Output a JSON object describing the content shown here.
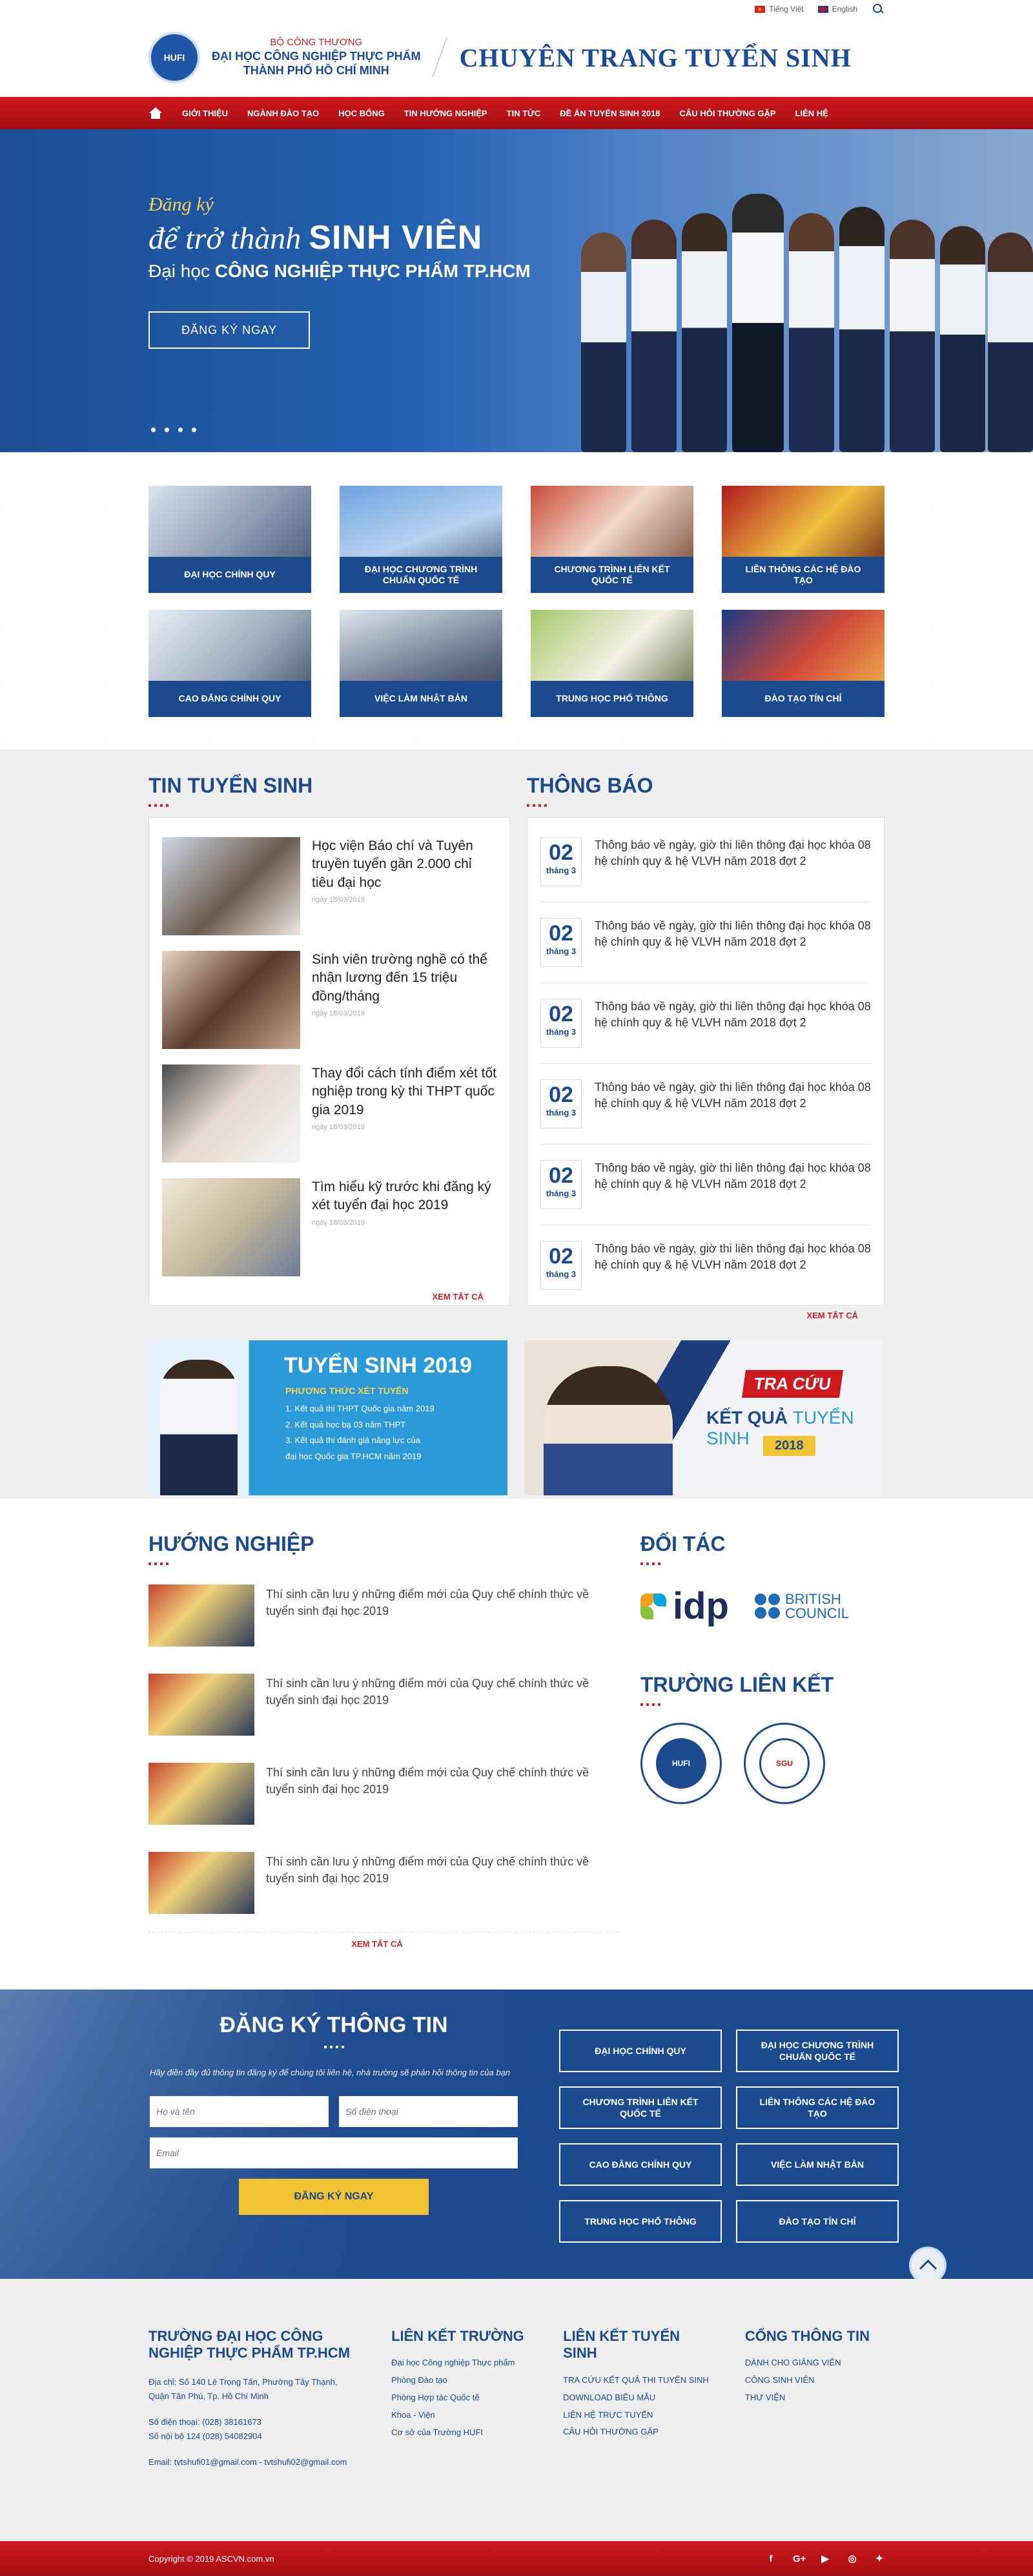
{
  "topbar": {
    "lang_vi": "Tiếng Việt",
    "lang_en": "English"
  },
  "header": {
    "logo_text": "HUFI",
    "ministry": "BỘ CÔNG THƯƠNG",
    "school_line1": "ĐẠI HỌC CÔNG NGHIỆP THỰC PHẨM",
    "school_line2": "THÀNH PHỐ HỒ CHÍ MINH",
    "site_title": "CHUYÊN TRANG TUYỂN SINH"
  },
  "nav": [
    "GIỚI THIỆU",
    "NGÀNH ĐÀO TẠO",
    "HỌC BỔNG",
    "TIN HƯỚNG NGHIỆP",
    "TIN TỨC",
    "ĐỀ ÁN TUYỂN SINH 2018",
    "CÂU HỎI THƯỜNG GẶP",
    "LIÊN HỆ"
  ],
  "hero": {
    "line1": "Đăng ký",
    "line2_a": "để trở thành ",
    "line2_b": "SINH VIÊN",
    "line3_a": "Đại học ",
    "line3_b": "CÔNG NGHIỆP THỰC PHẨM TP.HCM",
    "button": "ĐĂNG KÝ NGAY"
  },
  "programs": [
    "ĐẠI HỌC CHÍNH QUY",
    "ĐẠI HỌC CHƯƠNG TRÌNH CHUẨN QUỐC TẾ",
    "CHƯƠNG TRÌNH LIÊN KẾT QUỐC TẾ",
    "LIÊN THÔNG CÁC HỆ ĐÀO TẠO",
    "CAO ĐẲNG CHÍNH QUY",
    "VIỆC LÀM NHẬT BẢN",
    "TRUNG HỌC PHỔ THÔNG",
    "ĐÀO TẠO TÍN CHỈ"
  ],
  "news": {
    "title": "TIN TUYỂN SINH",
    "more": "XEM TẤT CẢ",
    "items": [
      {
        "headline": "Học viện Báo chí và Tuyên truyền tuyển gần 2.000 chỉ tiêu đại học",
        "date": "ngày 18/03/2019"
      },
      {
        "headline": "Sinh viên trường nghề có thể nhận lương đến 15 triệu đồng/tháng",
        "date": "ngày 18/03/2019"
      },
      {
        "headline": "Thay đổi cách tính điểm xét tốt nghiệp trong kỳ thi THPT quốc gia 2019",
        "date": "ngày 18/03/2019"
      },
      {
        "headline": "Tìm hiểu kỹ trước khi đăng ký xét tuyển đại học 2019",
        "date": "ngày 18/03/2019"
      }
    ]
  },
  "notices": {
    "title": "THÔNG BÁO",
    "more": "XEM TẤT CẢ",
    "items": [
      {
        "day": "02",
        "month": "tháng 3",
        "text": "Thông báo về ngày, giờ thi liên thông đại học khóa 08 hệ chính quy & hệ VLVH năm 2018 đợt 2"
      },
      {
        "day": "02",
        "month": "tháng 3",
        "text": "Thông báo về ngày, giờ thi liên thông đại học khóa 08 hệ chính quy & hệ VLVH năm 2018 đợt 2"
      },
      {
        "day": "02",
        "month": "tháng 3",
        "text": "Thông báo về ngày, giờ thi liên thông đại học khóa 08 hệ chính quy & hệ VLVH năm 2018 đợt 2"
      },
      {
        "day": "02",
        "month": "tháng 3",
        "text": "Thông báo về ngày, giờ thi liên thông đại học khóa 08 hệ chính quy & hệ VLVH năm 2018 đợt 2"
      },
      {
        "day": "02",
        "month": "tháng 3",
        "text": "Thông báo về ngày, giờ thi liên thông đại học khóa 08 hệ chính quy & hệ VLVH năm 2018 đợt 2"
      },
      {
        "day": "02",
        "month": "tháng 3",
        "text": "Thông báo về ngày, giờ thi liên thông đại học khóa 08 hệ chính quy & hệ VLVH năm 2018 đợt 2"
      }
    ]
  },
  "banner1": {
    "title": "TUYỂN SINH 2019",
    "subtitle": "PHƯƠNG THỨC XÉT TUYỂN",
    "l1": "1. Kết quả thi THPT Quốc gia năm 2019",
    "l2": "2. Kết quả học bạ 03 năm THPT",
    "l3": "3. Kết quả thi đánh giá năng lực của",
    "l4": "đại học Quốc gia TP.HCM năm 2019"
  },
  "banner2": {
    "badge": "TRA CỨU",
    "line_a": "KẾT QUẢ ",
    "line_b": "TUYỂN SINH",
    "year": "2018"
  },
  "career": {
    "title": "HƯỚNG NGHIỆP",
    "more": "XEM TẤT CẢ",
    "items": [
      "Thí sinh cần lưu ý những điểm mới của Quy chế chính thức về tuyển sinh đại học 2019",
      "Thí sinh cần lưu ý những điểm mới của Quy chế chính thức về tuyển sinh đại học 2019",
      "Thí sinh cần lưu ý những điểm mới của Quy chế chính thức về tuyển sinh đại học 2019",
      "Thí sinh cần lưu ý những điểm mới của Quy chế chính thức về tuyển sinh đại học 2019"
    ]
  },
  "partners": {
    "title": "ĐỐI TÁC",
    "idp": "idp",
    "bc_line1": "BRITISH",
    "bc_line2": "COUNCIL",
    "linked_title": "TRƯỜNG LIÊN KẾT",
    "seal1": "HUFI",
    "seal2": "SGU"
  },
  "register": {
    "title": "ĐĂNG KÝ THÔNG TIN",
    "desc": "Hãy điền đầy đủ thông tin đăng ký để chúng tôi liên hệ, nhà trường sẽ phản hồi thông tin của bạn",
    "name_ph": "Họ và tên",
    "phone_ph": "Số điện thoại",
    "email_ph": "Email",
    "button": "ĐĂNG KÝ NGAY",
    "links": [
      "ĐẠI HỌC CHÍNH QUY",
      "ĐẠI HỌC CHƯƠNG TRÌNH CHUẨN QUỐC TẾ",
      "CHƯƠNG TRÌNH LIÊN KẾT QUỐC TẾ",
      "LIÊN THÔNG CÁC HỆ ĐÀO TẠO",
      "CAO ĐẲNG CHÍNH QUY",
      "VIỆC LÀM NHẬT BẢN",
      "TRUNG HỌC PHỔ THÔNG",
      "ĐÀO TẠO TÍN CHỈ"
    ]
  },
  "footer": {
    "c1_title": "TRƯỜNG ĐẠI HỌC CÔNG NGHIỆP THỰC PHẨM TP.HCM",
    "addr1": "Địa chỉ: Số 140 Lê Trọng Tấn, Phường Tây Thạnh,",
    "addr2": "Quận Tân Phú, Tp. Hồ Chí Minh",
    "phone1": "Số điện thoại: (028) 38161673",
    "phone2": "Số nội bộ 124 (028) 54082904",
    "email": "Email: tvtshufi01@gmail.com - tvtshufi02@gmail.com",
    "c2_title": "LIÊN KẾT TRƯỜNG",
    "c2": [
      "Đại học Công nghiệp Thực phẩm",
      "Phòng Đào tạo",
      "Phòng Hợp tác Quốc tế",
      "Khoa - Viện",
      "Cơ sở của Trường HUFI"
    ],
    "c3_title": "LIÊN KẾT TUYỂN SINH",
    "c3": [
      "TRA CỨU KẾT QUẢ THI TUYỂN SINH",
      "DOWNLOAD BIỂU MẪU",
      "LIÊN HỆ TRỰC TUYẾN",
      "CÂU HỎI THƯỜNG GẶP"
    ],
    "c4_title": "CỔNG THÔNG TIN",
    "c4": [
      "DÀNH CHO GIẢNG VIÊN",
      "CÔNG SINH VIÊN",
      "THƯ VIỆN"
    ],
    "copyright": "Copyright © 2019 ASCVN.com.vn"
  },
  "colors": {
    "brand_blue": "#1c4a8f",
    "brand_red": "#d0181f",
    "accent_yellow": "#f1c333"
  }
}
